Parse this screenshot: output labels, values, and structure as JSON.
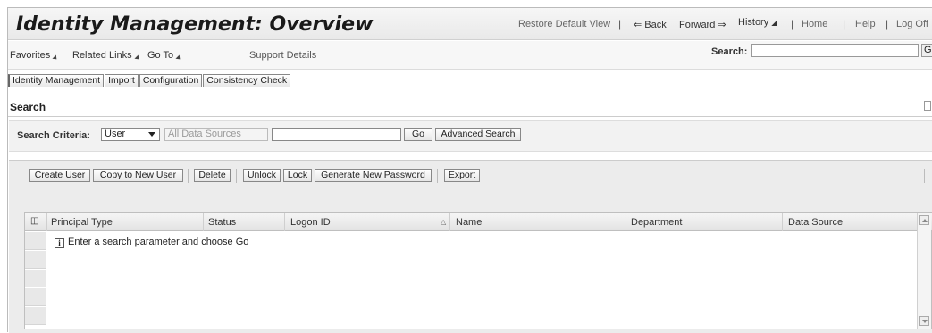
{
  "header": {
    "title": "Identity Management: Overview",
    "restore": "Restore Default View",
    "back": "Back",
    "forward": "Forward",
    "history": "History",
    "home": "Home",
    "help": "Help",
    "logoff": "Log Off",
    "sep": "|"
  },
  "menubar": {
    "favorites": "Favorites",
    "related_links": "Related Links",
    "go_to": "Go To",
    "support": "Support Details",
    "search_label": "Search:",
    "search_value": "",
    "search_go": "G"
  },
  "tabs": [
    {
      "label": "Identity Management"
    },
    {
      "label": "Import"
    },
    {
      "label": "Configuration"
    },
    {
      "label": "Consistency Check"
    }
  ],
  "search_section": {
    "title": "Search",
    "criteria_label": "Search Criteria:",
    "criteria_value": "User",
    "data_source_placeholder": "All Data Sources",
    "query_value": "",
    "go_label": "Go",
    "advanced_label": "Advanced Search"
  },
  "toolbar": {
    "create_user": "Create User",
    "copy_user": "Copy to New User",
    "delete": "Delete",
    "unlock": "Unlock",
    "lock": "Lock",
    "generate_password": "Generate New Password",
    "export": "Export"
  },
  "table": {
    "columns": [
      "Principal Type",
      "Status",
      "Logon ID",
      "Name",
      "Department",
      "Data Source"
    ],
    "empty_message": "Enter a search parameter and choose Go",
    "info_glyph": "i"
  },
  "colors": {
    "header_bg": "#eeeeee",
    "toolbar_bg": "#ececec",
    "border": "#888888"
  }
}
